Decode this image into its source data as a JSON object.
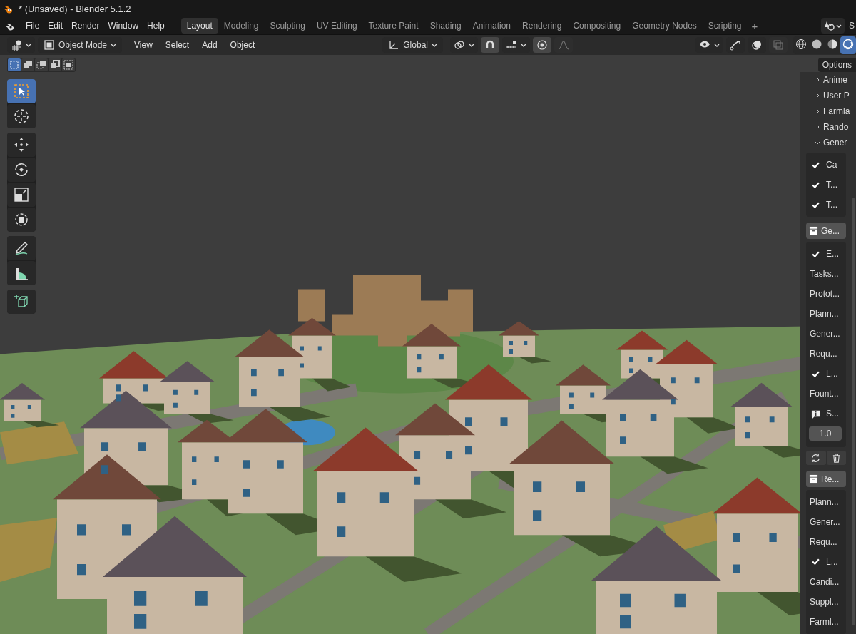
{
  "window": {
    "title": "* (Unsaved) - Blender 5.1.2"
  },
  "menu": [
    "File",
    "Edit",
    "Render",
    "Window",
    "Help"
  ],
  "workspaces": [
    {
      "label": "Layout",
      "selected": true
    },
    {
      "label": "Modeling",
      "selected": false
    },
    {
      "label": "Sculpting",
      "selected": false
    },
    {
      "label": "UV Editing",
      "selected": false
    },
    {
      "label": "Texture Paint",
      "selected": false
    },
    {
      "label": "Shading",
      "selected": false
    },
    {
      "label": "Animation",
      "selected": false
    },
    {
      "label": "Rendering",
      "selected": false
    },
    {
      "label": "Compositing",
      "selected": false
    },
    {
      "label": "Geometry Nodes",
      "selected": false
    },
    {
      "label": "Scripting",
      "selected": false
    }
  ],
  "add_workspace": "+",
  "scene_selector": {
    "label": "S"
  },
  "viewport_header": {
    "mode": "Object Mode",
    "menus": [
      "View",
      "Select",
      "Add",
      "Object"
    ],
    "orientation": "Global"
  },
  "shading_modes": [
    {
      "kind": "wireframe",
      "selected": false
    },
    {
      "kind": "solid",
      "selected": false
    },
    {
      "kind": "material",
      "selected": false
    },
    {
      "kind": "rendered",
      "selected": true
    }
  ],
  "select_modes": [
    {
      "kind": "new",
      "selected": true
    },
    {
      "kind": "extend",
      "selected": false
    },
    {
      "kind": "subtract",
      "selected": false
    },
    {
      "kind": "invert",
      "selected": false
    },
    {
      "kind": "intersect",
      "selected": false
    }
  ],
  "toolbar": [
    [
      {
        "kind": "select",
        "selected": true
      },
      {
        "kind": "cursor",
        "selected": false
      }
    ],
    [
      {
        "kind": "move",
        "selected": false
      },
      {
        "kind": "rotate",
        "selected": false
      },
      {
        "kind": "scale",
        "selected": false
      },
      {
        "kind": "transform",
        "selected": false
      }
    ],
    [
      {
        "kind": "annotate",
        "selected": false
      },
      {
        "kind": "measure",
        "selected": false
      }
    ],
    [
      {
        "kind": "add_cube",
        "selected": false
      }
    ]
  ],
  "options_button": "Options",
  "sidebar": {
    "tabs": [
      {
        "label": "Anime",
        "expanded": false
      },
      {
        "label": "User P",
        "expanded": false
      },
      {
        "label": "Farmla",
        "expanded": false
      },
      {
        "label": "Rando",
        "expanded": false
      },
      {
        "label": "Gener",
        "expanded": true
      }
    ],
    "panel": [
      {
        "kind": "group",
        "items": [
          {
            "kind": "check",
            "label": "Ca",
            "checked": true
          },
          {
            "kind": "check",
            "label": "T...",
            "checked": true
          },
          {
            "kind": "check",
            "label": "T...",
            "checked": true
          }
        ]
      },
      {
        "kind": "button",
        "label": "Ge..."
      },
      {
        "kind": "group",
        "items": [
          {
            "kind": "check",
            "label": "E...",
            "checked": true
          },
          {
            "kind": "label",
            "label": "Tasks..."
          },
          {
            "kind": "label",
            "label": "Protot..."
          },
          {
            "kind": "label",
            "label": "Plann..."
          },
          {
            "kind": "label",
            "label": "Gener..."
          },
          {
            "kind": "label",
            "label": "Requ..."
          },
          {
            "kind": "check",
            "label": "L...",
            "checked": true
          },
          {
            "kind": "label",
            "label": "Fount..."
          },
          {
            "kind": "info",
            "label": "S..."
          },
          {
            "kind": "number",
            "label": "1.0"
          }
        ]
      },
      {
        "kind": "icon_row",
        "icons": [
          {
            "kind": "refresh"
          },
          {
            "kind": "delete"
          }
        ]
      },
      {
        "kind": "button",
        "label": "Re..."
      },
      {
        "kind": "group",
        "items": [
          {
            "kind": "label",
            "label": "Plann..."
          },
          {
            "kind": "label",
            "label": "Gener..."
          },
          {
            "kind": "label",
            "label": "Requ..."
          },
          {
            "kind": "check",
            "label": "L...",
            "checked": true
          },
          {
            "kind": "label",
            "label": "Candi..."
          },
          {
            "kind": "label",
            "label": "Suppl..."
          },
          {
            "kind": "label",
            "label": "Farml..."
          }
        ]
      }
    ]
  }
}
